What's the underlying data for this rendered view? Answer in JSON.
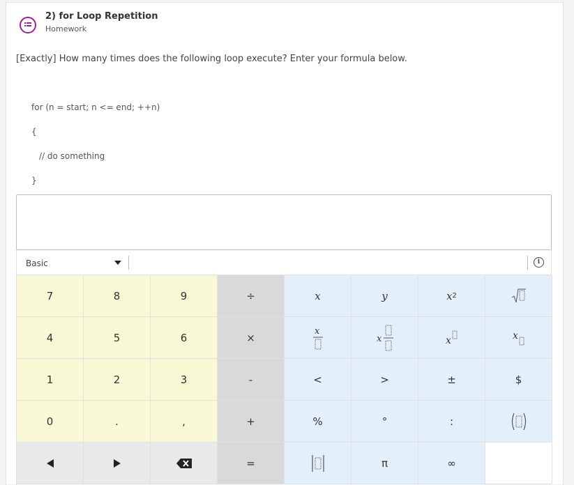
{
  "header": {
    "title": "2) for Loop Repetition",
    "subtitle": "Homework",
    "icon": "discussion-list-icon",
    "accent_color": "#9c1f9c"
  },
  "question": {
    "text": "[Exactly] How many times does the following loop execute?  Enter your formula below.",
    "code": [
      "for (n = start; n <= end; ++n)",
      "{",
      "// do something",
      "}"
    ]
  },
  "answer": {
    "value": ""
  },
  "toolbar": {
    "mode_label": "Basic",
    "info_icon": "info-icon"
  },
  "keypad": {
    "row1": [
      "7",
      "8",
      "9",
      "÷",
      "x",
      "y",
      "x²",
      "√"
    ],
    "row2": [
      "4",
      "5",
      "6",
      "×",
      "fraction",
      "mixed-fraction",
      "superscript",
      "subscript"
    ],
    "row3": [
      "1",
      "2",
      "3",
      "-",
      "<",
      ">",
      "±",
      "$"
    ],
    "row4": [
      "0",
      ".",
      ",",
      "+",
      "%",
      "°",
      ":",
      "parentheses"
    ],
    "row5": [
      "◀",
      "▶",
      "backspace",
      "=",
      "absolute-value",
      "π",
      "∞",
      ""
    ],
    "labels": {
      "x": "x",
      "y": "y",
      "x_base": "x",
      "x_sup": "2",
      "le": "<",
      "ge": ">",
      "pm": "±",
      "dollar": "$",
      "percent": "%",
      "degree": "°",
      "colon": ":",
      "pi": "π",
      "infinity": "∞",
      "equals": "=",
      "divide": "÷",
      "times": "×",
      "minus": "-",
      "plus": "+",
      "dot": ".",
      "comma": ","
    },
    "colors": {
      "number": "#f9f9d6",
      "operator": "#d9d9d9",
      "function": "#e3f0fb",
      "nav": "#e9e9e9"
    }
  }
}
